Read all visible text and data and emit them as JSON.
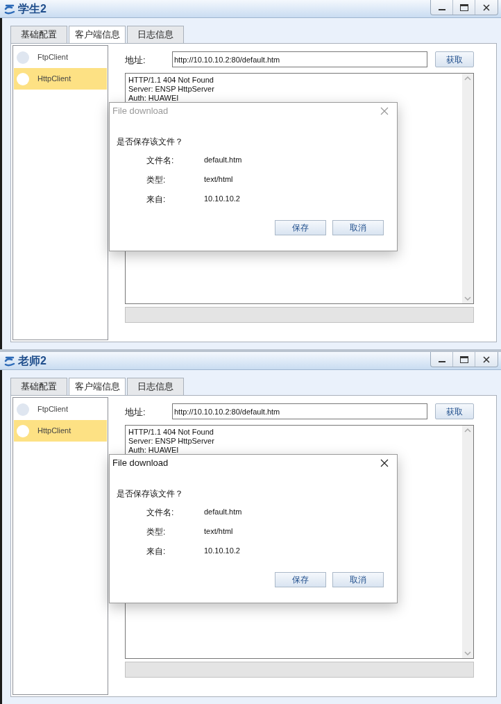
{
  "windows": [
    {
      "title": "学生2",
      "tabs": [
        {
          "label": "基础配置",
          "selected": false
        },
        {
          "label": "客户端信息",
          "selected": true
        },
        {
          "label": "日志信息",
          "selected": false
        }
      ],
      "sidebar": {
        "items": [
          {
            "label": "FtpClient",
            "selected": false
          },
          {
            "label": "HttpClient",
            "selected": true
          }
        ]
      },
      "address": {
        "label": "地址:",
        "value": "http://10.10.10.2:80/default.htm"
      },
      "fetch_button": "获取",
      "response_lines": [
        "HTTP/1.1 404 Not Found",
        "Server: ENSP HttpServer",
        "Auth: HUAWEI"
      ],
      "progress": {
        "level": 0
      },
      "dialog": {
        "title": "File download",
        "active": false,
        "question": "是否保存该文件？",
        "fields": [
          {
            "label": "文件名:",
            "value": "default.htm"
          },
          {
            "label": "类型:",
            "value": "text/html"
          },
          {
            "label": "来自:",
            "value": "10.10.10.2"
          }
        ],
        "buttons": [
          "保存",
          "取消"
        ]
      }
    },
    {
      "title": "老师2",
      "tabs": [
        {
          "label": "基础配置",
          "selected": false
        },
        {
          "label": "客户端信息",
          "selected": true
        },
        {
          "label": "日志信息",
          "selected": false
        }
      ],
      "sidebar": {
        "items": [
          {
            "label": "FtpClient",
            "selected": false
          },
          {
            "label": "HttpClient",
            "selected": true
          }
        ]
      },
      "address": {
        "label": "地址:",
        "value": "http://10.10.10.2:80/default.htm"
      },
      "fetch_button": "获取",
      "response_lines": [
        "HTTP/1.1 404 Not Found",
        "Server: ENSP HttpServer",
        "Auth: HUAWEI"
      ],
      "progress": {
        "level": 0
      },
      "dialog": {
        "title": "File download",
        "active": true,
        "question": "是否保存该文件？",
        "fields": [
          {
            "label": "文件名:",
            "value": "default.htm"
          },
          {
            "label": "类型:",
            "value": "text/html"
          },
          {
            "label": "来自:",
            "value": "10.10.10.2"
          }
        ],
        "buttons": [
          "保存",
          "取消"
        ]
      }
    }
  ]
}
